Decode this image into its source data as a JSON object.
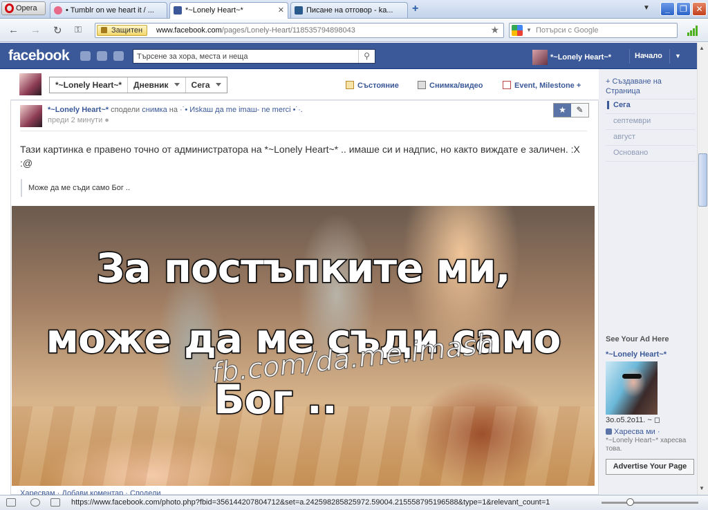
{
  "browser": {
    "opera_label": "Opera",
    "tabs": [
      {
        "title": "• Tumblr on we heart it / ...",
        "favicon_color": "#e76a8a"
      },
      {
        "title": "*~Lonely Heart~*",
        "favicon_color": "#3b5998"
      },
      {
        "title": "Писане на отговор - ka...",
        "favicon_color": "#2a5a8c"
      }
    ],
    "secure_label": "Защитен",
    "url_domain": "www.facebook.com",
    "url_path": "/pages/Lonely-Heart/118535794898043",
    "search_placeholder": "Потърси с Google",
    "status_url": "https://www.facebook.com/photo.php?fbid=356144207804712&set=a.242598285825972.59004.215558795196588&type=1&relevant_count=1"
  },
  "fb_header": {
    "logo": "facebook",
    "search_placeholder": "Търсене за хора, места и неща",
    "user_name": "*~Lonely Heart~*",
    "home_label": "Начало",
    "brand_color": "#3b5998"
  },
  "page_bar": {
    "page_name": "*~Lonely Heart~*",
    "journal_label": "Дневник",
    "now_label": "Сега",
    "status_label": "Състояние",
    "photo_label": "Снимка/видео",
    "event_label": "Event, Milestone +"
  },
  "post": {
    "author": "*~Lonely Heart~*",
    "shared_text": "сподели",
    "photo_link": "снимка",
    "on_text": "на",
    "source_page": "·˙• Иskaш да me imaш- ne merci •˙·.",
    "time": "преди 2 минути",
    "text": "Тази картинка е правено точно от администратора на *~Lonely Heart~* .. имаше си и надпис, но както виждате е заличен. :X :@",
    "quote": "Може да ме съди само Бог ..",
    "photo_caption_1": "За постъпките ми,",
    "photo_caption_2": "може да ме съди само",
    "photo_caption_3": "Бог ..",
    "watermark": "fb.com/da.me.imash",
    "below_photo": "Харесвам · Добави коментар · Сподели"
  },
  "timeline": {
    "create_page": "Създаване на Страница",
    "items": [
      "Сега",
      "септември",
      "август",
      "Основано"
    ]
  },
  "ad": {
    "heading": "See Your Ad Here",
    "title": "*~Lonely Heart~*",
    "date": "3o.o5.2o11. ~",
    "like_label": "Харесва ми ·",
    "liked_by": "*~Lonely Heart~* харесва това.",
    "advertise_button": "Advertise Your Page"
  }
}
